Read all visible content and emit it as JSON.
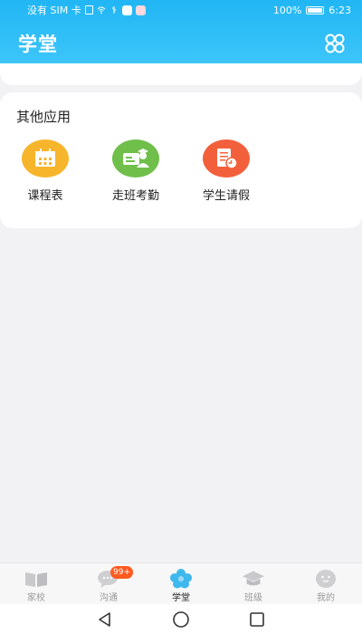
{
  "status_bar": {
    "carrier": "没有 SIM 卡",
    "battery": "100%",
    "time": "6:23"
  },
  "header": {
    "title": "学堂",
    "menu_icon": "grid-icon"
  },
  "other_apps": {
    "title": "其他应用",
    "items": [
      {
        "label": "课程表",
        "icon": "calendar-icon",
        "color": "#f7b52c"
      },
      {
        "label": "走班考勤",
        "icon": "attendance-icon",
        "color": "#6fbf4a"
      },
      {
        "label": "学生请假",
        "icon": "leave-form-icon",
        "color": "#f2603b"
      }
    ]
  },
  "tabbar": {
    "items": [
      {
        "label": "家校",
        "icon": "book-icon"
      },
      {
        "label": "沟通",
        "icon": "chat-icon",
        "badge": "99+"
      },
      {
        "label": "学堂",
        "icon": "flower-icon",
        "active": true
      },
      {
        "label": "班级",
        "icon": "graduation-cap-icon"
      },
      {
        "label": "我的",
        "icon": "profile-face-icon"
      }
    ]
  },
  "colors": {
    "header": "#21b6f4",
    "badge": "#ff5a1f",
    "background": "#f2f2f5"
  }
}
